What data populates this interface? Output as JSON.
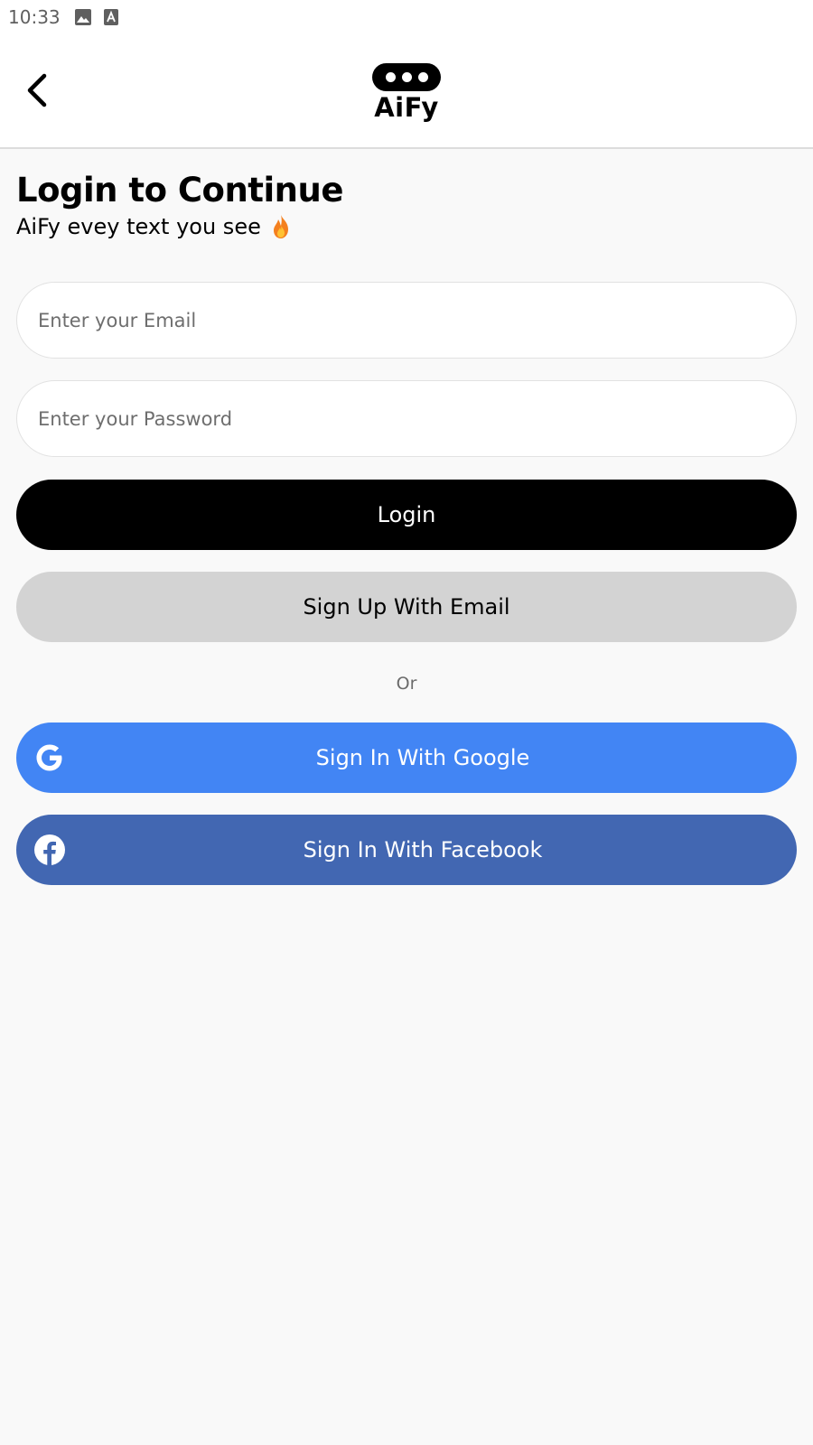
{
  "status_bar": {
    "time": "10:33",
    "icons": [
      "image-icon",
      "text-icon"
    ]
  },
  "app_bar": {
    "back_icon": "chevron-left-icon",
    "logo_text": "AiFy"
  },
  "header": {
    "title": "Login to Continue",
    "subtitle": "AiFy evey text you see",
    "subtitle_icon": "fire-emoji-icon"
  },
  "form": {
    "email_placeholder": "Enter your Email",
    "email_value": "",
    "password_placeholder": "Enter your Password",
    "password_value": ""
  },
  "buttons": {
    "login_label": "Login",
    "signup_label": "Sign Up With Email",
    "or_label": "Or",
    "google_label": "Sign In With Google",
    "facebook_label": "Sign In With Facebook"
  },
  "colors": {
    "login_bg": "#000000",
    "signup_bg": "#d3d3d3",
    "google_bg": "#4285f4",
    "facebook_bg": "#4267b2"
  }
}
